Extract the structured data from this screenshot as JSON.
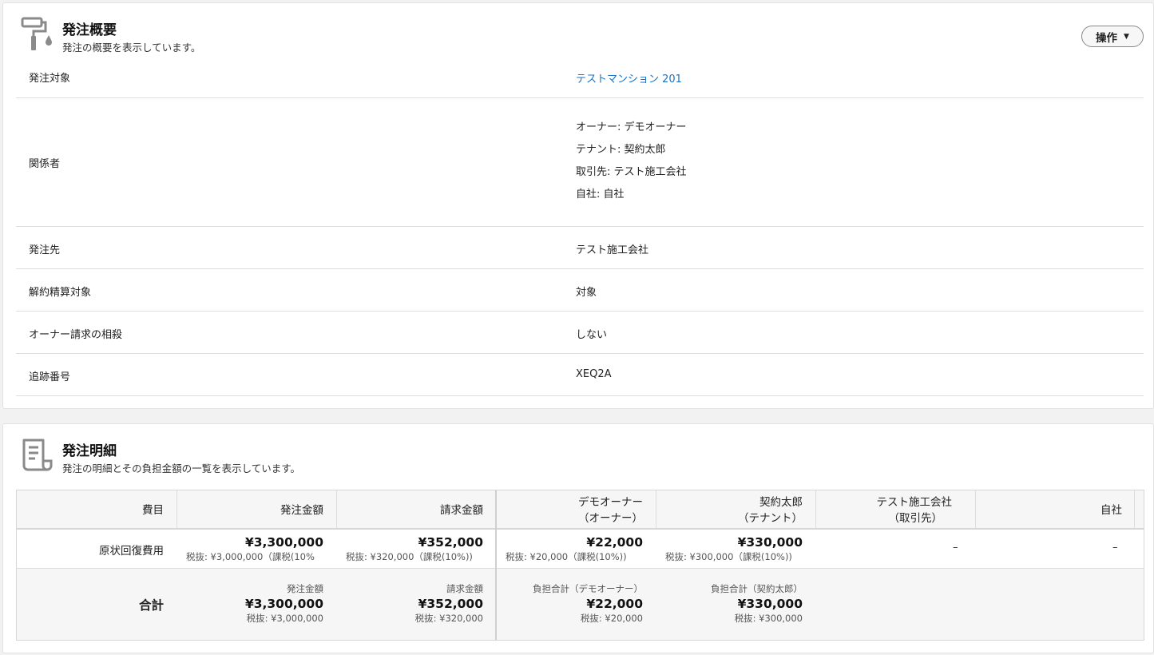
{
  "overview": {
    "title": "発注概要",
    "subtitle": "発注の概要を表示しています。",
    "operation_button": "操作",
    "rows": [
      {
        "label": "発注対象",
        "value": "テストマンション 201"
      },
      {
        "label": "関係者",
        "parties": [
          "オーナー: デモオーナー",
          "テナント: 契約太郎",
          "取引先: テスト施工会社",
          "自社: 自社"
        ]
      },
      {
        "label": "発注先",
        "value": "テスト施工会社"
      },
      {
        "label": "解約精算対象",
        "value": "対象"
      },
      {
        "label": "オーナー請求の相殺",
        "value": "しない"
      },
      {
        "label": "追跡番号",
        "value": "XEQ2A"
      }
    ]
  },
  "detail": {
    "title": "発注明細",
    "subtitle": "発注の明細とその負担金額の一覧を表示しています。",
    "headers": {
      "item": "費目",
      "order_amount": "発注金額",
      "bill_amount": "請求金額",
      "owner_name": "デモオーナー",
      "owner_role": "（オーナー）",
      "tenant_name": "契約太郎",
      "tenant_role": "（テナント）",
      "vendor_name": "テスト施工会社",
      "vendor_role": "（取引先）",
      "self": "自社"
    },
    "row": {
      "item": "原状回復費用",
      "order_amount": "¥3,300,000",
      "order_detail": "税抜: ¥3,000,000（課税(10%",
      "bill_amount": "¥352,000",
      "bill_detail": "税抜: ¥320,000（課税(10%))",
      "owner_amount": "¥22,000",
      "owner_detail": "税抜: ¥20,000（課税(10%))",
      "tenant_amount": "¥330,000",
      "tenant_detail": "税抜: ¥300,000（課税(10%))",
      "vendor_amount": "–",
      "self_amount": "–"
    },
    "total": {
      "label": "合計",
      "order_caption": "発注金額",
      "order_amount": "¥3,300,000",
      "order_detail": "税抜: ¥3,000,000",
      "bill_caption": "請求金額",
      "bill_amount": "¥352,000",
      "bill_detail": "税抜: ¥320,000",
      "owner_caption": "負担合計（デモオーナー）",
      "owner_amount": "¥22,000",
      "owner_detail": "税抜: ¥20,000",
      "tenant_caption": "負担合計（契約太郎）",
      "tenant_amount": "¥330,000",
      "tenant_detail": "税抜: ¥300,000"
    }
  },
  "icons": {
    "overview": "paint-roller-icon",
    "detail": "receipt-document-icon"
  },
  "colors": {
    "link": "#1a73c8",
    "icon": "#8a8a8a"
  }
}
